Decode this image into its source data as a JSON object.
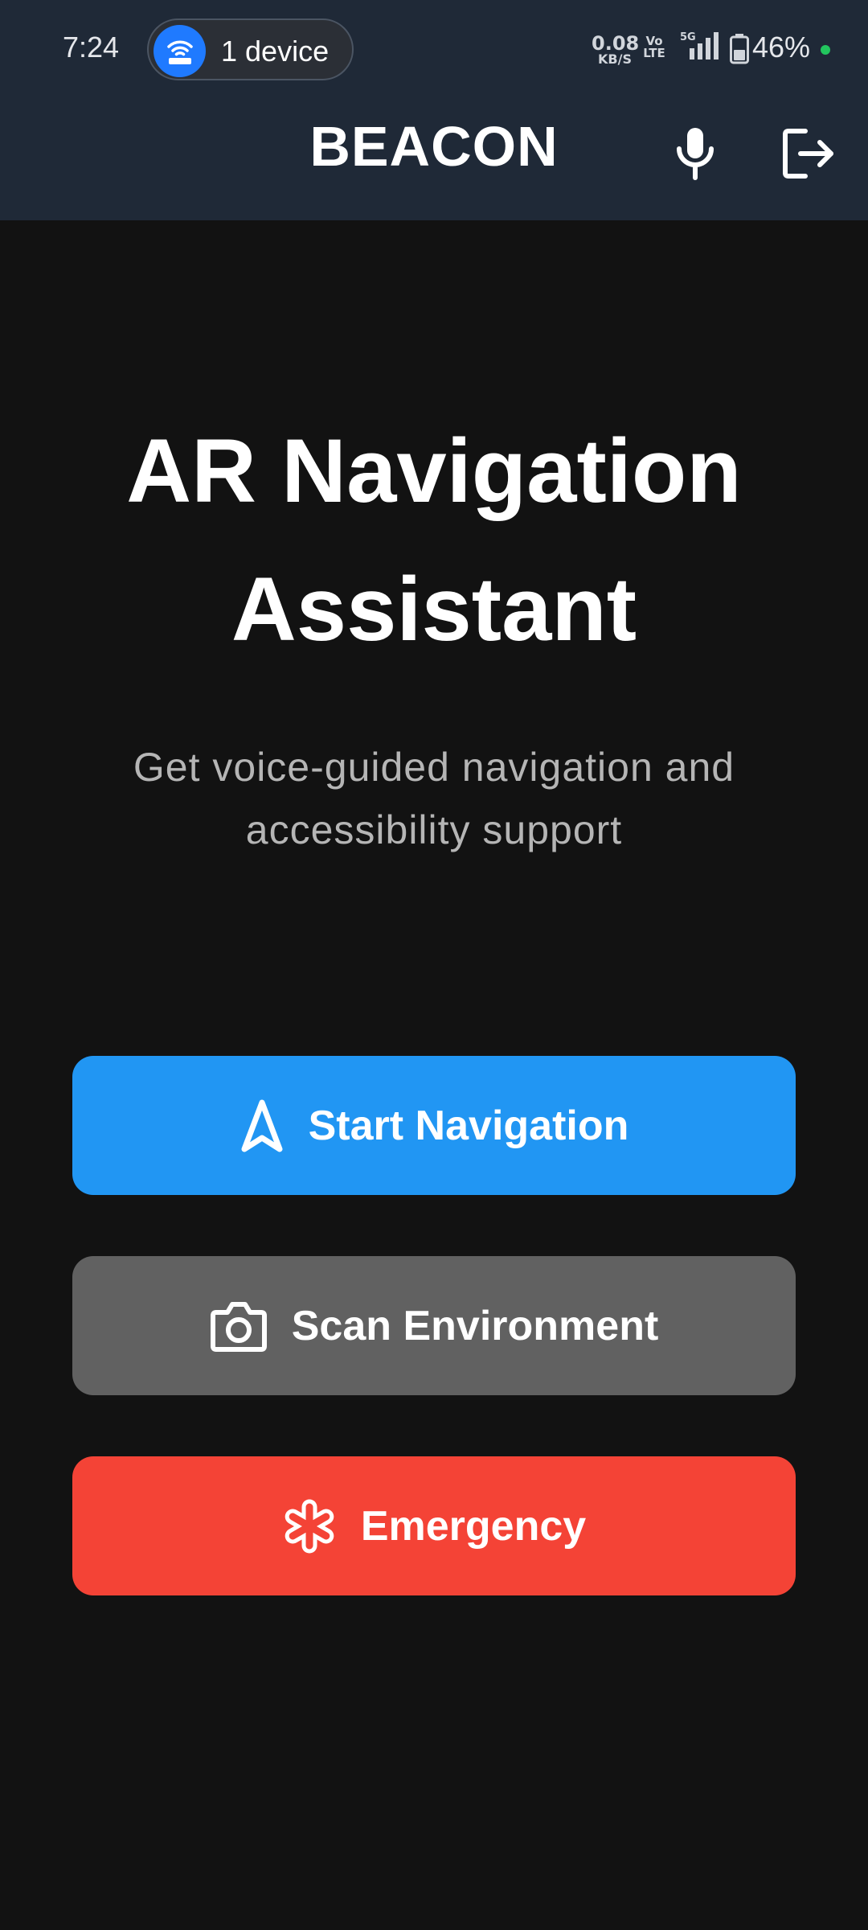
{
  "status_bar": {
    "time": "7:24",
    "hotspot_label": "1 device",
    "net_speed_value": "0.08",
    "net_speed_unit": "KB/S",
    "volte_top": "Vo",
    "volte_bottom": "LTE",
    "network": "5G",
    "battery": "46%",
    "hotspot_icon": "wifi-router-icon",
    "indicator_color": "#22c55e"
  },
  "app_bar": {
    "title": "BEACON",
    "mic_icon": "microphone-icon",
    "logout_icon": "logout-icon",
    "background": "#1f2937"
  },
  "main": {
    "title": "AR Navigation Assistant",
    "subtitle": "Get voice-guided navigation and accessibility support"
  },
  "actions": [
    {
      "label": "Start Navigation",
      "icon": "navigation-arrow-icon",
      "color": "#2196f3"
    },
    {
      "label": "Scan Environment",
      "icon": "camera-icon",
      "color": "#616161"
    },
    {
      "label": "Emergency",
      "icon": "medical-asterisk-icon",
      "color": "#f44336"
    }
  ]
}
